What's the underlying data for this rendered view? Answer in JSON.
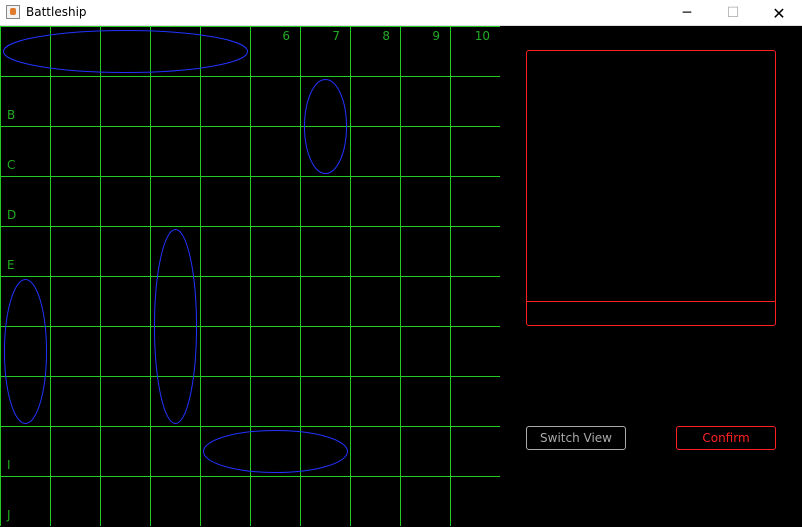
{
  "window": {
    "title": "Battleship",
    "minimize_glyph": "─",
    "maximize_glyph": "☐",
    "close_glyph": "✕"
  },
  "board": {
    "column_labels": [
      "",
      "",
      "",
      "",
      "",
      "6",
      "7",
      "8",
      "9",
      "10"
    ],
    "row_labels": [
      "",
      "B",
      "C",
      "D",
      "E",
      "",
      "",
      "",
      "I",
      "J"
    ],
    "grid_color": "#22cc22",
    "label_color": "#22aa22",
    "ship_color": "#2233ff",
    "ships": [
      {
        "col": 0,
        "row": 0,
        "length": 5,
        "orientation": "horizontal"
      },
      {
        "col": 6,
        "row": 1,
        "length": 2,
        "orientation": "vertical"
      },
      {
        "col": 3,
        "row": 4,
        "length": 4,
        "orientation": "vertical"
      },
      {
        "col": 0,
        "row": 5,
        "length": 3,
        "orientation": "vertical"
      },
      {
        "col": 4,
        "row": 8,
        "length": 3,
        "orientation": "horizontal"
      }
    ]
  },
  "panel": {
    "accent_color": "#ff2020",
    "switch_view_label": "Switch View",
    "confirm_label": "Confirm"
  }
}
